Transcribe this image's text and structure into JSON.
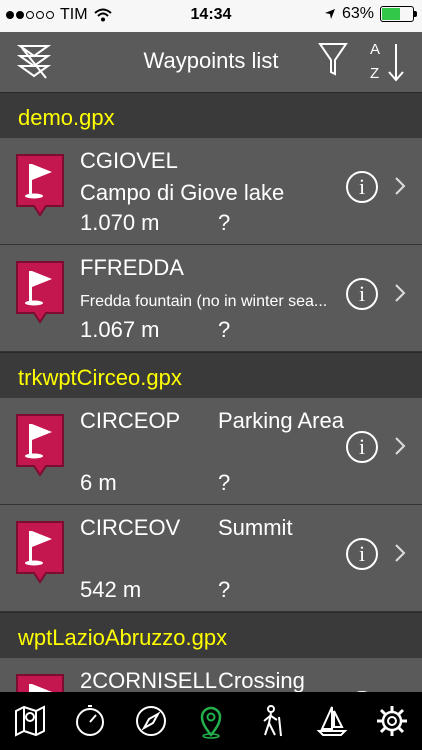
{
  "status": {
    "carrier": "TIM",
    "time": "14:34",
    "battery": "63%",
    "battery_level": 0.63
  },
  "nav": {
    "title": "Waypoints list",
    "sort_a": "A",
    "sort_z": "Z"
  },
  "sections": [
    {
      "title": "demo.gpx",
      "rows": [
        {
          "name": "CGIOVEL",
          "desc": "Campo di Giove lake",
          "elevation": "1.070 m",
          "extra": "?"
        },
        {
          "name": "FFREDDA",
          "desc": "Fredda fountain (no in winter sea...",
          "elevation": "1.067 m",
          "extra": "?"
        }
      ]
    },
    {
      "title": "trkwptCirceo.gpx",
      "rows": [
        {
          "name": "CIRCEOP",
          "desc": "Parking Area",
          "elevation": "6 m",
          "extra": "?"
        },
        {
          "name": "CIRCEOV",
          "desc": "Summit",
          "elevation": "542 m",
          "extra": "?"
        }
      ]
    },
    {
      "title": "wptLazioAbruzzo.gpx",
      "rows": [
        {
          "name": "2CORNISELL",
          "desc": "Crossing"
        }
      ]
    }
  ],
  "colors": {
    "accent": "#ffff00",
    "flag_bg": "#c4164f",
    "tab_active": "#22b14c"
  },
  "tabs": [
    "map-icon",
    "compass-dial-icon",
    "compass-icon",
    "waypoint-pin-icon",
    "hiker-icon",
    "sailboat-icon",
    "gear-icon"
  ]
}
